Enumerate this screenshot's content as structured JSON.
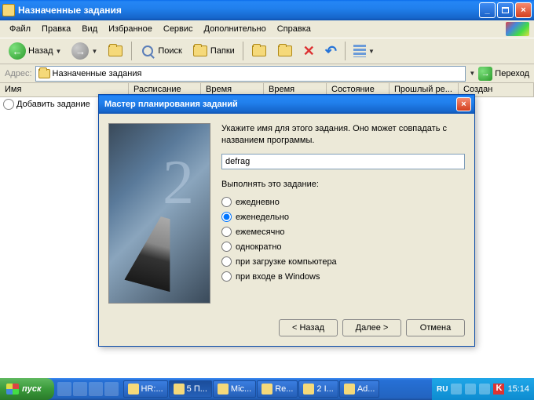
{
  "window": {
    "title": "Назначенные задания",
    "menu": [
      "Файл",
      "Правка",
      "Вид",
      "Избранное",
      "Сервис",
      "Дополнительно",
      "Справка"
    ],
    "toolbar": {
      "back": "Назад",
      "search": "Поиск",
      "folders": "Папки"
    },
    "address": {
      "label": "Адрес:",
      "value": "Назначенные задания",
      "go": "Переход"
    },
    "columns": [
      "Имя",
      "Расписание",
      "Время следу...",
      "Время прош...",
      "Состояние",
      "Прошлый ре...",
      "Создан"
    ],
    "row_add": "Добавить задание"
  },
  "dialog": {
    "title": "Мастер планирования заданий",
    "prompt": "Укажите имя для этого задания. Оно может совпадать с названием программы.",
    "name_value": "defrag",
    "schedule_label": "Выполнять это задание:",
    "options": [
      {
        "label": "ежедневно",
        "checked": false
      },
      {
        "label": "еженедельно",
        "checked": true
      },
      {
        "label": "ежемесячно",
        "checked": false
      },
      {
        "label": "однократно",
        "checked": false
      },
      {
        "label": "при загрузке компьютера",
        "checked": false
      },
      {
        "label": "при входе в Windows",
        "checked": false
      }
    ],
    "buttons": {
      "back": "< Назад",
      "next": "Далее >",
      "cancel": "Отмена"
    }
  },
  "taskbar": {
    "start": "пуск",
    "tasks": [
      {
        "label": "HR:..."
      },
      {
        "label": "5 П..."
      },
      {
        "label": "Mic..."
      },
      {
        "label": "Re..."
      },
      {
        "label": "2 I..."
      },
      {
        "label": "Ad..."
      }
    ],
    "lang": "RU",
    "time": "15:14"
  }
}
